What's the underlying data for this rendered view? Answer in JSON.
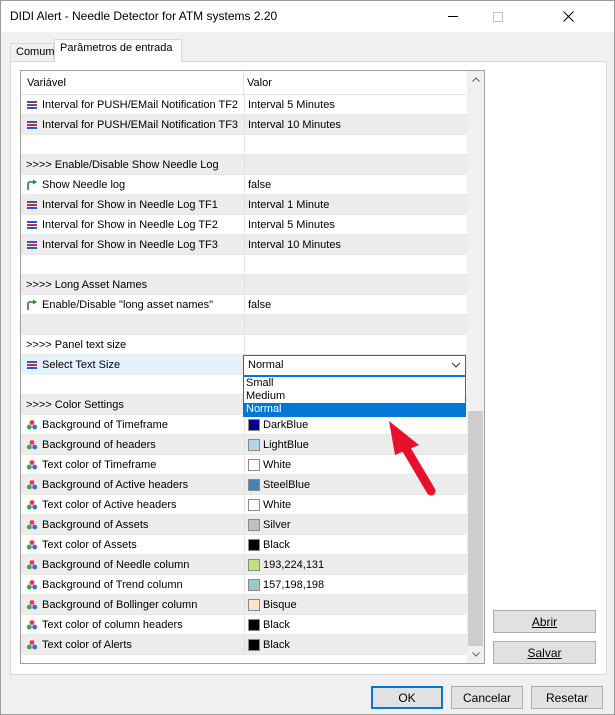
{
  "window": {
    "title": "DIDI Alert - Needle Detector for ATM systems 2.20"
  },
  "tabs": [
    {
      "label": "Comum"
    },
    {
      "label": "Parâmetros de entrada"
    }
  ],
  "grid": {
    "col_name": "Variável",
    "col_value": "Valor",
    "rows": [
      {
        "kind": "param",
        "icon": "list-icon",
        "name": "Interval for PUSH/EMail Notification TF2",
        "value": "Interval 5 Minutes"
      },
      {
        "kind": "param",
        "icon": "list-icon",
        "name": "Interval for PUSH/EMail Notification TF3",
        "value": "Interval 10 Minutes"
      },
      {
        "kind": "empty",
        "name": "",
        "value": ""
      },
      {
        "kind": "section",
        "name": ">>>> Enable/Disable Show Needle Log",
        "value": ""
      },
      {
        "kind": "param",
        "icon": "bool-arrow-icon",
        "name": "Show Needle log",
        "value": "false"
      },
      {
        "kind": "param",
        "icon": "list-icon",
        "name": "Interval for Show in Needle Log TF1",
        "value": "Interval 1 Minute"
      },
      {
        "kind": "param",
        "icon": "list-icon",
        "name": "Interval for Show in Needle Log TF2",
        "value": "Interval 5 Minutes"
      },
      {
        "kind": "param",
        "icon": "list-icon",
        "name": "Interval for Show in Needle Log TF3",
        "value": "Interval 10 Minutes"
      },
      {
        "kind": "empty",
        "name": "",
        "value": ""
      },
      {
        "kind": "section",
        "name": ">>>> Long Asset Names",
        "value": ""
      },
      {
        "kind": "param",
        "icon": "bool-arrow-icon",
        "name": "Enable/Disable \"long asset names\"",
        "value": "false"
      },
      {
        "kind": "empty",
        "name": "",
        "value": ""
      },
      {
        "kind": "section",
        "name": ">>>> Panel text size",
        "value": ""
      },
      {
        "kind": "param",
        "icon": "list-icon",
        "name": "Select Text Size",
        "value": "",
        "selected": true
      },
      {
        "kind": "empty",
        "name": "",
        "value": ""
      },
      {
        "kind": "section",
        "name": ">>>> Color Settings",
        "value": ""
      },
      {
        "kind": "color",
        "name": "Background of Timeframe",
        "value": "DarkBlue",
        "color": "#00008b"
      },
      {
        "kind": "color",
        "name": "Background of headers",
        "value": "LightBlue",
        "color": "#add8e6"
      },
      {
        "kind": "color",
        "name": "Text color of Timeframe",
        "value": "White",
        "color": "#ffffff"
      },
      {
        "kind": "color",
        "name": "Background of Active headers",
        "value": "SteelBlue",
        "color": "#4682b4"
      },
      {
        "kind": "color",
        "name": "Text color of Active headers",
        "value": "White",
        "color": "#ffffff"
      },
      {
        "kind": "color",
        "name": "Background of Assets",
        "value": "Silver",
        "color": "#c0c0c0"
      },
      {
        "kind": "color",
        "name": "Text color of Assets",
        "value": "Black",
        "color": "#000000"
      },
      {
        "kind": "color",
        "name": "Background of Needle column",
        "value": "193,224,131",
        "color": "#c1e083"
      },
      {
        "kind": "color",
        "name": "Background of Trend column",
        "value": "157,198,198",
        "color": "#9dc6c6"
      },
      {
        "kind": "color",
        "name": "Background of Bollinger column",
        "value": "Bisque",
        "color": "#ffe4c4"
      },
      {
        "kind": "color",
        "name": "Text color of column headers",
        "value": "Black",
        "color": "#000000"
      },
      {
        "kind": "color",
        "name": "Text color of Alerts",
        "value": "Black",
        "color": "#000000"
      }
    ]
  },
  "dropdown": {
    "value": "Normal",
    "options": [
      {
        "label": "Small"
      },
      {
        "label": "Medium"
      },
      {
        "label": "Normal",
        "active": true
      }
    ]
  },
  "buttons": {
    "abrir": "Abrir",
    "salvar": "Salvar",
    "ok": "OK",
    "cancelar": "Cancelar",
    "resetar": "Resetar"
  }
}
